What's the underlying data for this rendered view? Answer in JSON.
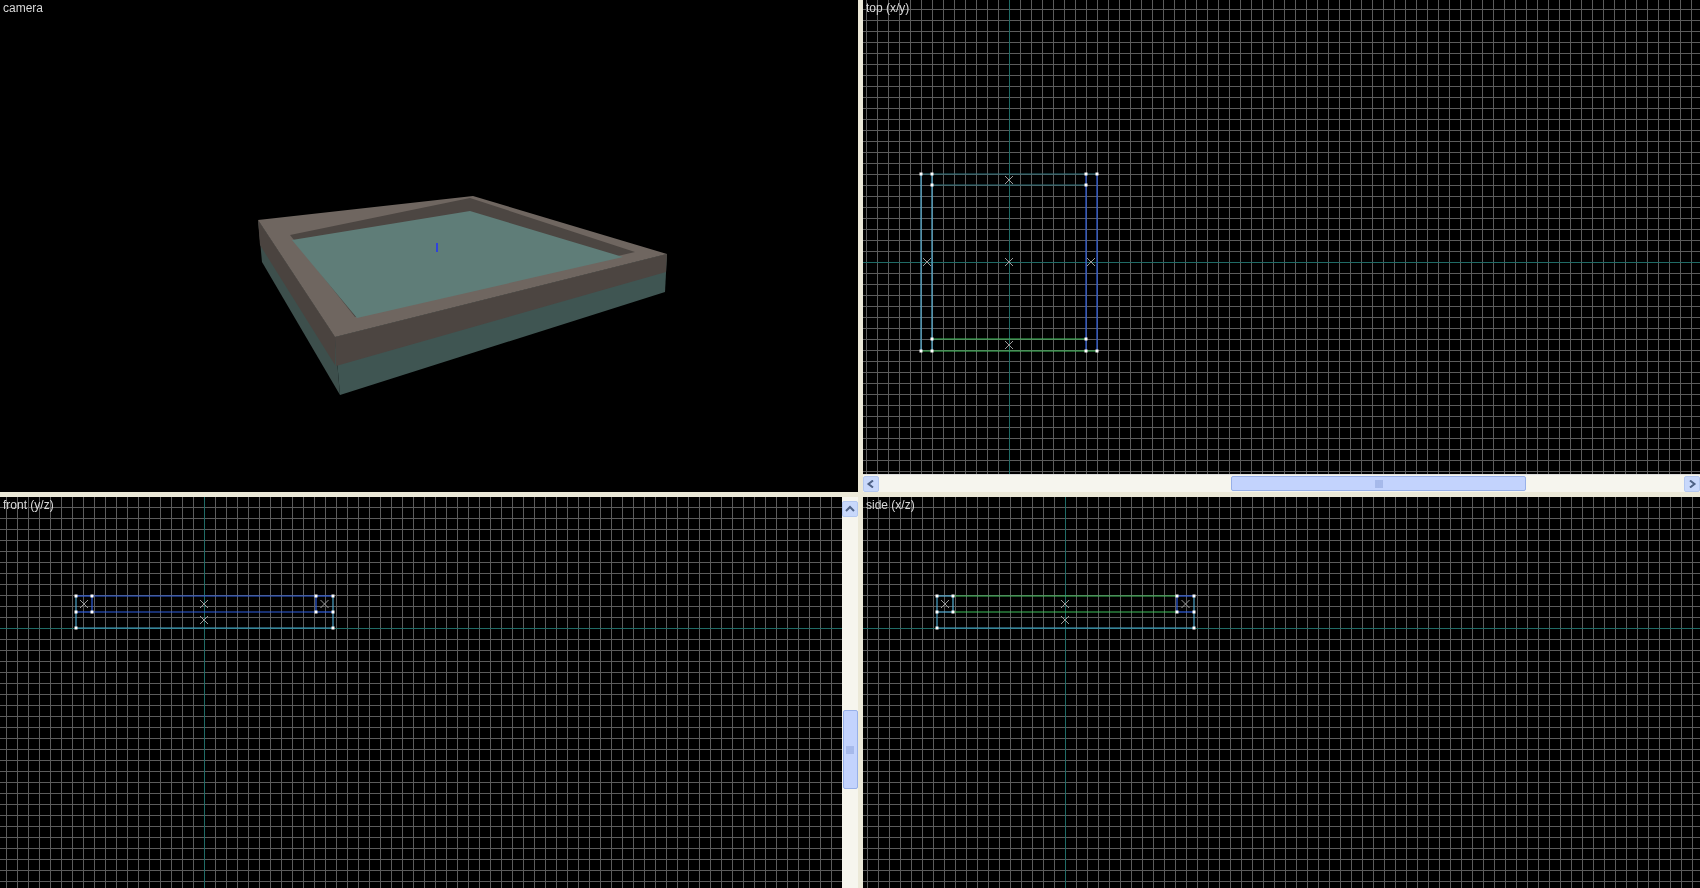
{
  "viewports": [
    {
      "title": "camera",
      "kind": "camera"
    },
    {
      "title": "top (x/y)",
      "kind": "top",
      "horizontal_scrollbar": true
    },
    {
      "title": "front (y/z)",
      "kind": "front",
      "vertical_scrollbar": true
    },
    {
      "title": "side (x/z)",
      "kind": "side"
    }
  ]
}
